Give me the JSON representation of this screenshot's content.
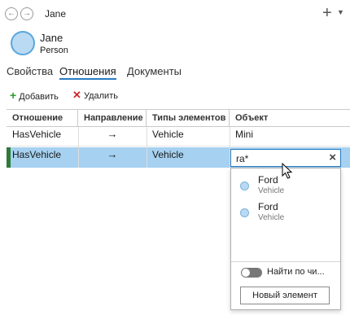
{
  "window": {
    "title": "Jane"
  },
  "header": {
    "name": "Jane",
    "type": "Person"
  },
  "tabs": [
    {
      "label": "Свойства"
    },
    {
      "label": "Отношения"
    },
    {
      "label": "Документы"
    }
  ],
  "toolbar": {
    "add_label": "Добавить",
    "delete_label": "Удалить"
  },
  "grid": {
    "columns": [
      "Отношение",
      "Направление",
      "Типы элементов",
      "Объект"
    ],
    "rows": [
      {
        "relation": "HasVehicle",
        "direction": "→",
        "types": "Vehicle",
        "object": "Mini"
      },
      {
        "relation": "HasVehicle",
        "direction": "→",
        "types": "Vehicle",
        "object": "ra*"
      }
    ]
  },
  "search": {
    "value": "ra*"
  },
  "dropdown": {
    "results": [
      {
        "title": "Ford",
        "subtitle": "Vehicle"
      },
      {
        "title": "Ford",
        "subtitle": "Vehicle"
      }
    ],
    "toggle_label": "Найти по чи...",
    "new_element_label": "Новый элемент"
  },
  "colors": {
    "accent": "#2a7ac0",
    "selected_row": "#a6d1f0",
    "add_icon": "#2d9b2d",
    "delete_icon": "#cc2a2a"
  }
}
